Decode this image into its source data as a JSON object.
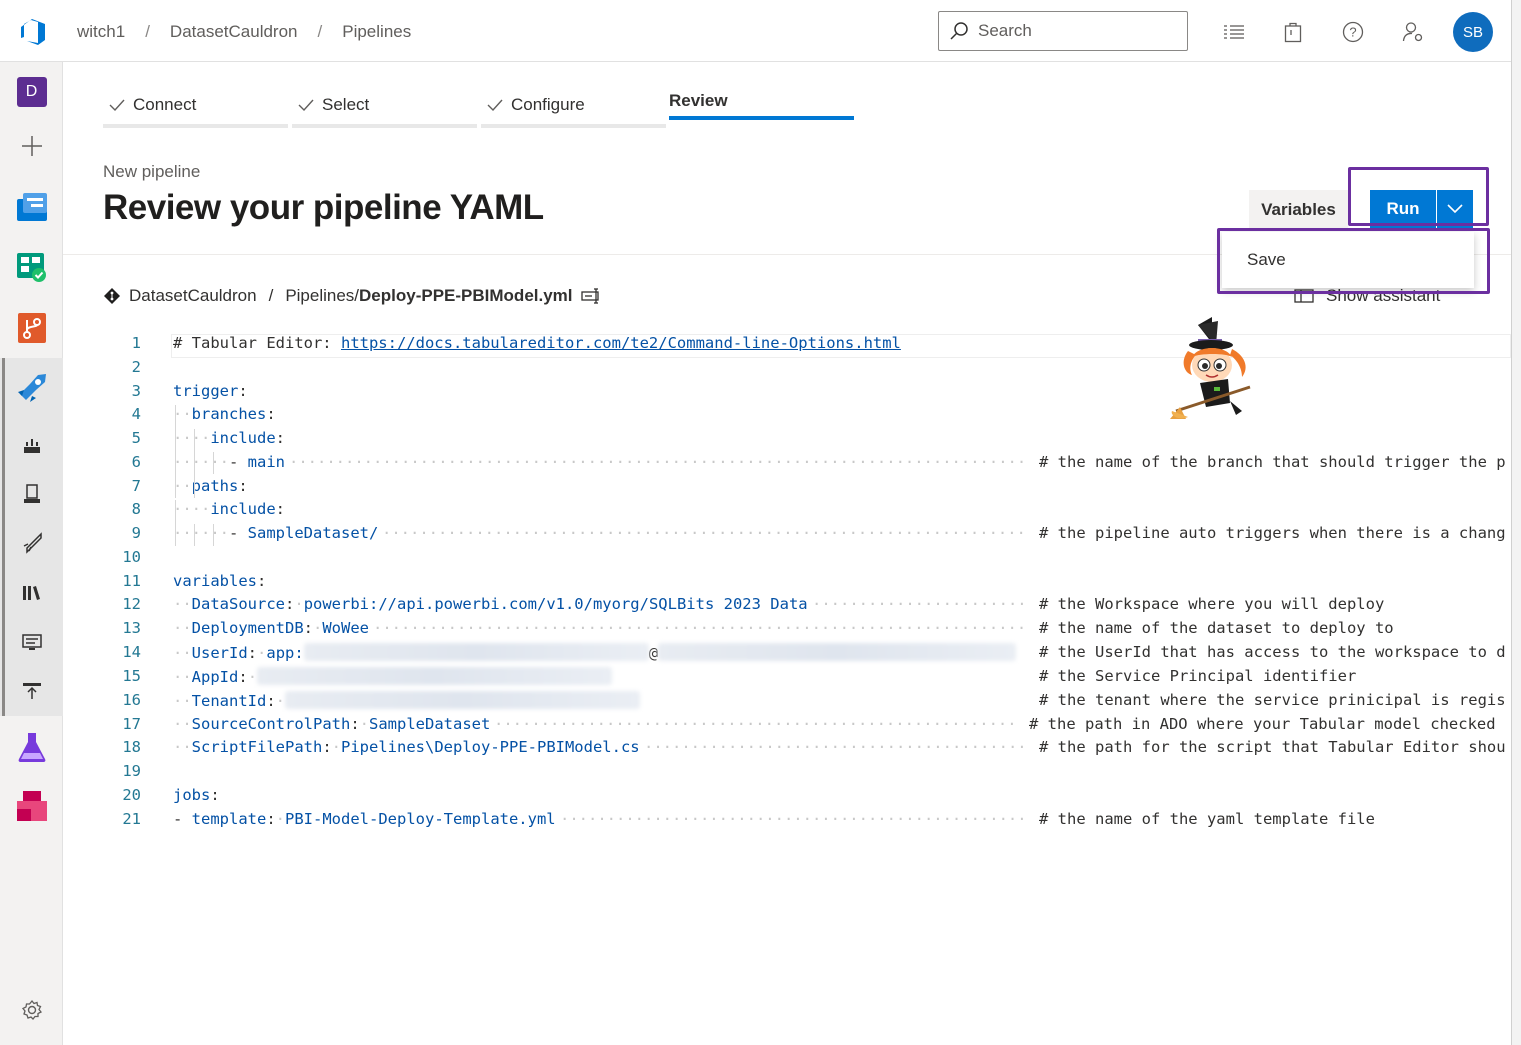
{
  "header": {
    "breadcrumbs": [
      "witch1",
      "DatasetCauldron",
      "Pipelines"
    ],
    "search_placeholder": "Search",
    "avatar_initials": "SB"
  },
  "rail": {
    "project_initial": "D"
  },
  "wizard": {
    "steps": [
      {
        "label": "Connect",
        "done": true
      },
      {
        "label": "Select",
        "done": true
      },
      {
        "label": "Configure",
        "done": true
      },
      {
        "label": "Review",
        "done": false,
        "active": true
      }
    ]
  },
  "page": {
    "subtitle": "New pipeline",
    "title": "Review your pipeline YAML",
    "variables_label": "Variables",
    "run_label": "Run",
    "dropdown_item": "Save",
    "repo": "DatasetCauldron",
    "path_prefix": "Pipelines/",
    "file_name": "Deploy-PPE-PBIModel.yml",
    "show_assistant": "Show assistant"
  },
  "editor": {
    "lines": [
      {
        "n": "1",
        "code": "# Tabular Editor: ",
        "url": "https://docs.tabulareditor.com/te2/Command-line-Options.html"
      },
      {
        "n": "2",
        "code": ""
      },
      {
        "n": "3",
        "key": "trigger",
        "indent": 0
      },
      {
        "n": "4",
        "key": "branches",
        "indent": 1
      },
      {
        "n": "5",
        "key": "include",
        "indent": 2
      },
      {
        "n": "6",
        "item": "main",
        "indent": 3,
        "comment": "# the name of the branch that should trigger the p"
      },
      {
        "n": "7",
        "key": "paths",
        "indent": 1
      },
      {
        "n": "8",
        "key": "include",
        "indent": 2
      },
      {
        "n": "9",
        "item": "SampleDataset/",
        "indent": 3,
        "comment": "# the pipeline auto triggers when there is a chang"
      },
      {
        "n": "10",
        "code": ""
      },
      {
        "n": "11",
        "key": "variables",
        "indent": 0
      },
      {
        "n": "12",
        "key": "DataSource",
        "value": "powerbi://api.powerbi.com/v1.0/myorg/SQLBits 2023 Data",
        "indent": 1,
        "comment": "# the Workspace where you will deploy"
      },
      {
        "n": "13",
        "key": "DeploymentDB",
        "value": "WoWee",
        "indent": 1,
        "comment": "# the name of the dataset to deploy to"
      },
      {
        "n": "14",
        "key": "UserId",
        "value": "app:",
        "indent": 1,
        "comment": "# the UserId that has access to the workspace to d"
      },
      {
        "n": "15",
        "key": "AppId",
        "value": "",
        "indent": 1,
        "comment": "# the Service Principal identifier"
      },
      {
        "n": "16",
        "key": "TenantId",
        "value": "",
        "indent": 1,
        "comment": "# the tenant where the service prinicipal is regis"
      },
      {
        "n": "17",
        "key": "SourceControlPath",
        "value": "SampleDataset",
        "indent": 1,
        "comment": "# the path in ADO where your Tabular model checked"
      },
      {
        "n": "18",
        "key": "ScriptFilePath",
        "value": "Pipelines\\Deploy-PPE-PBIModel.cs",
        "indent": 1,
        "comment": "# the path for the script that Tabular Editor shou"
      },
      {
        "n": "19",
        "code": ""
      },
      {
        "n": "20",
        "key": "jobs",
        "indent": 0
      },
      {
        "n": "21",
        "key": "template",
        "value": "PBI-Model-Deploy-Template.yml",
        "dash": true,
        "indent": 0,
        "comment": "# the name of the yaml template file"
      }
    ]
  },
  "colors": {
    "accent": "#0078d4",
    "highlight": "#6b2fa0",
    "yaml_key": "#0451a5",
    "line_number": "#237893"
  }
}
